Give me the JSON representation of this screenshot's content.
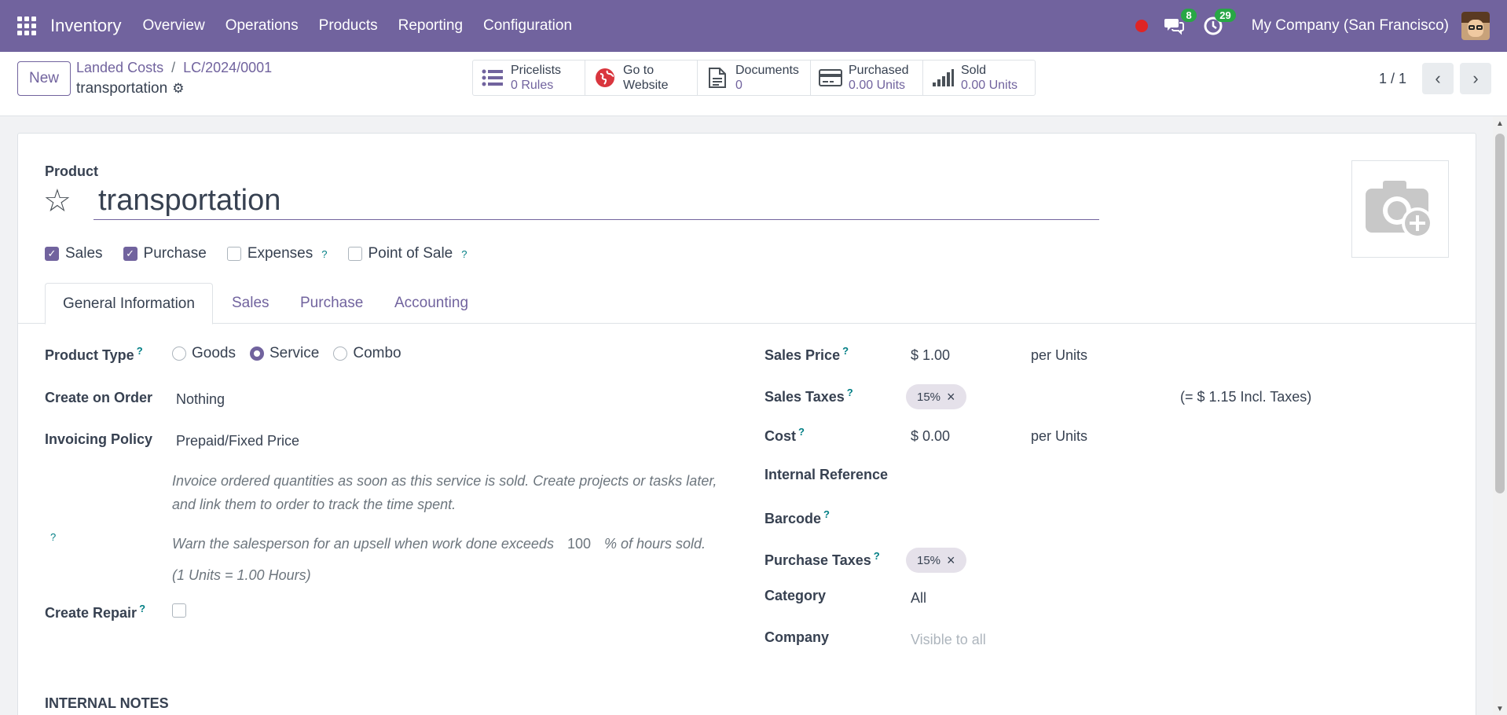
{
  "navbar": {
    "app_name": "Inventory",
    "menu": [
      "Overview",
      "Operations",
      "Products",
      "Reporting",
      "Configuration"
    ],
    "messages_count": "8",
    "activities_count": "29",
    "company": "My Company (San Francisco)"
  },
  "control": {
    "new_label": "New",
    "breadcrumb": [
      "Landed Costs",
      "LC/2024/0001"
    ],
    "record_name": "transportation",
    "smart_buttons": [
      {
        "label": "Pricelists",
        "value": "0 Rules",
        "icon": "list-icon"
      },
      {
        "label": "Go to",
        "value": "Website",
        "icon": "globe-icon"
      },
      {
        "label": "Documents",
        "value": "0",
        "icon": "document-icon"
      },
      {
        "label": "Purchased",
        "value": "0.00 Units",
        "icon": "credit-card-icon"
      },
      {
        "label": "Sold",
        "value": "0.00 Units",
        "icon": "bar-chart-icon"
      }
    ],
    "pager": "1 / 1"
  },
  "form": {
    "product_label": "Product",
    "product_name": "transportation",
    "checkboxes": [
      {
        "label": "Sales",
        "checked": true,
        "help": false
      },
      {
        "label": "Purchase",
        "checked": true,
        "help": false
      },
      {
        "label": "Expenses",
        "checked": false,
        "help": true
      },
      {
        "label": "Point of Sale",
        "checked": false,
        "help": true
      }
    ],
    "tabs": [
      "General Information",
      "Sales",
      "Purchase",
      "Accounting"
    ],
    "active_tab": "General Information",
    "left": {
      "product_type_label": "Product Type",
      "product_type_options": [
        "Goods",
        "Service",
        "Combo"
      ],
      "product_type_selected": "Service",
      "create_on_order_label": "Create on Order",
      "create_on_order_value": "Nothing",
      "invoicing_policy_label": "Invoicing Policy",
      "invoicing_policy_value": "Prepaid/Fixed Price",
      "invoicing_help_1": "Invoice ordered quantities as soon as this service is sold. Create projects or tasks later,",
      "invoicing_help_2": "and link them to order to track the time spent.",
      "upsell_help_prefix": "Warn the salesperson for an upsell when work done exceeds",
      "upsell_value": "100",
      "upsell_help_suffix": "% of hours sold.",
      "units_note": "(1 Units = 1.00 Hours)",
      "create_repair_label": "Create Repair"
    },
    "right": {
      "sales_price_label": "Sales Price",
      "sales_price_value": "$ 1.00",
      "sales_price_unit": "per  Units",
      "sales_taxes_label": "Sales Taxes",
      "sales_taxes_tag": "15%",
      "sales_taxes_incl": "(= $ 1.15 Incl. Taxes)",
      "cost_label": "Cost",
      "cost_value": "$ 0.00",
      "cost_unit": "per Units",
      "internal_ref_label": "Internal Reference",
      "barcode_label": "Barcode",
      "purchase_taxes_label": "Purchase Taxes",
      "purchase_taxes_tag": "15%",
      "category_label": "Category",
      "category_value": "All",
      "company_label": "Company",
      "company_placeholder": "Visible to all"
    },
    "internal_notes_label": "INTERNAL NOTES"
  },
  "colors": {
    "brand": "#71639e",
    "help": "#017e84",
    "badge": "#28a745",
    "record": "#e02424"
  }
}
